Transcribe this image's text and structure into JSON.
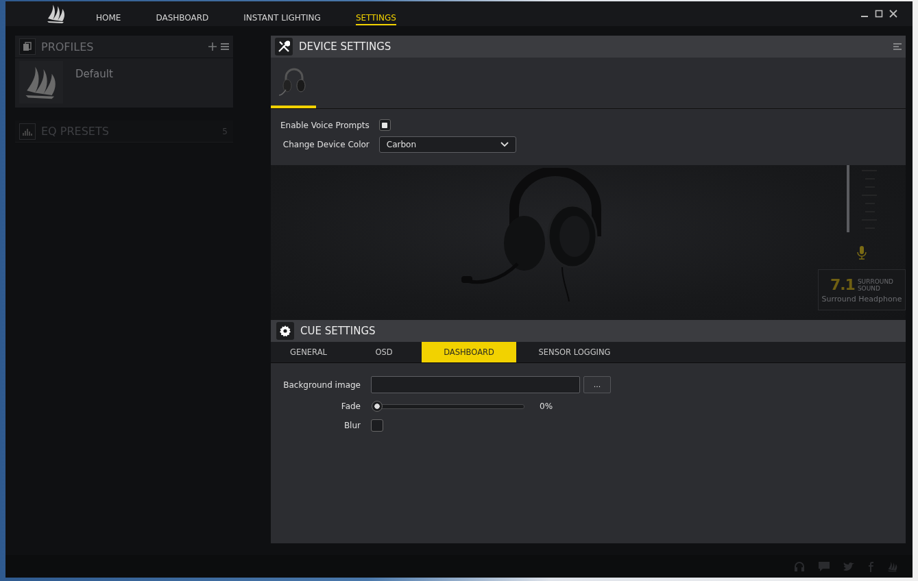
{
  "nav": {
    "tabs": [
      {
        "label": "HOME",
        "selected": false
      },
      {
        "label": "DASHBOARD",
        "selected": false
      },
      {
        "label": "INSTANT LIGHTING",
        "selected": false
      },
      {
        "label": "SETTINGS",
        "selected": true
      }
    ]
  },
  "sidebar": {
    "profiles": {
      "title": "PROFILES",
      "items": [
        {
          "name": "Default",
          "selected": true
        }
      ]
    },
    "eq_presets": {
      "title": "EQ PRESETS",
      "count": "5"
    }
  },
  "device_settings": {
    "title": "DEVICE SETTINGS",
    "devices": [
      {
        "selected": true
      }
    ],
    "voice_prompts": {
      "label": "Enable Voice Prompts",
      "checked": true
    },
    "device_color": {
      "label": "Change Device Color",
      "value": "Carbon"
    }
  },
  "surround": {
    "number": "7.1",
    "line_1": "SURROUND",
    "line_2": "SOUND",
    "mode": "Surround Headphone"
  },
  "cue_settings": {
    "title": "CUE SETTINGS",
    "tabs": [
      {
        "label": "GENERAL",
        "selected": false
      },
      {
        "label": "OSD",
        "selected": false
      },
      {
        "label": "DASHBOARD",
        "selected": true
      },
      {
        "label": "SENSOR LOGGING",
        "selected": false
      }
    ],
    "background_image": {
      "label": "Background image",
      "browse_button": "..."
    },
    "fade": {
      "label": "Fade",
      "level": 0,
      "reading": "0%"
    },
    "blur": {
      "label": "Blur",
      "checked": false
    }
  }
}
